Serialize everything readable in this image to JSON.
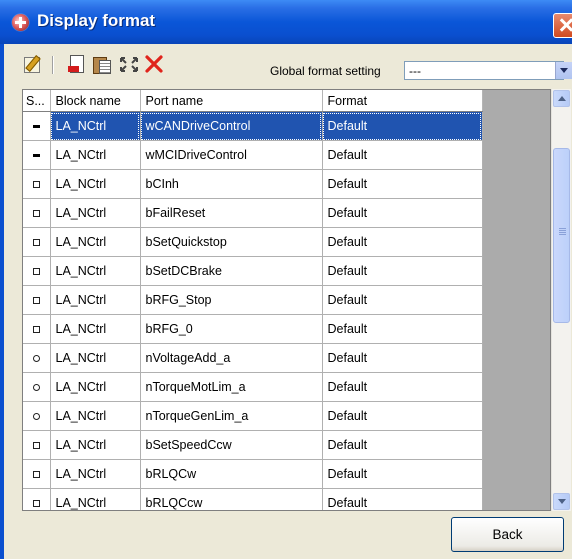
{
  "window": {
    "title": "Display format"
  },
  "toolbar": {
    "buttons": [
      {
        "icon": "edit-icon"
      },
      {
        "icon": "document-icon"
      },
      {
        "icon": "paste-icon"
      },
      {
        "icon": "expand-icon"
      },
      {
        "icon": "delete-icon"
      }
    ],
    "global_format_label": "Global format setting",
    "global_format_value": "---"
  },
  "grid": {
    "columns": [
      "S...",
      "Block name",
      "Port name",
      "Format"
    ],
    "rows": [
      {
        "s": "bar",
        "block": "LA_NCtrl",
        "port": "wCANDriveControl",
        "format": "Default",
        "selected": true
      },
      {
        "s": "bar",
        "block": "LA_NCtrl",
        "port": "wMCIDriveControl",
        "format": "Default"
      },
      {
        "s": "square",
        "block": "LA_NCtrl",
        "port": "bCInh",
        "format": "Default"
      },
      {
        "s": "square",
        "block": "LA_NCtrl",
        "port": "bFailReset",
        "format": "Default"
      },
      {
        "s": "square",
        "block": "LA_NCtrl",
        "port": "bSetQuickstop",
        "format": "Default"
      },
      {
        "s": "square",
        "block": "LA_NCtrl",
        "port": "bSetDCBrake",
        "format": "Default"
      },
      {
        "s": "square",
        "block": "LA_NCtrl",
        "port": "bRFG_Stop",
        "format": "Default"
      },
      {
        "s": "square",
        "block": "LA_NCtrl",
        "port": "bRFG_0",
        "format": "Default"
      },
      {
        "s": "circle",
        "block": "LA_NCtrl",
        "port": "nVoltageAdd_a",
        "format": "Default"
      },
      {
        "s": "circle",
        "block": "LA_NCtrl",
        "port": "nTorqueMotLim_a",
        "format": "Default"
      },
      {
        "s": "circle",
        "block": "LA_NCtrl",
        "port": "nTorqueGenLim_a",
        "format": "Default"
      },
      {
        "s": "square",
        "block": "LA_NCtrl",
        "port": "bSetSpeedCcw",
        "format": "Default"
      },
      {
        "s": "square",
        "block": "LA_NCtrl",
        "port": "bRLQCw",
        "format": "Default"
      },
      {
        "s": "square",
        "block": "LA_NCtrl",
        "port": "bRLQCcw",
        "format": "Default"
      }
    ]
  },
  "footer": {
    "back_label": "Back"
  }
}
